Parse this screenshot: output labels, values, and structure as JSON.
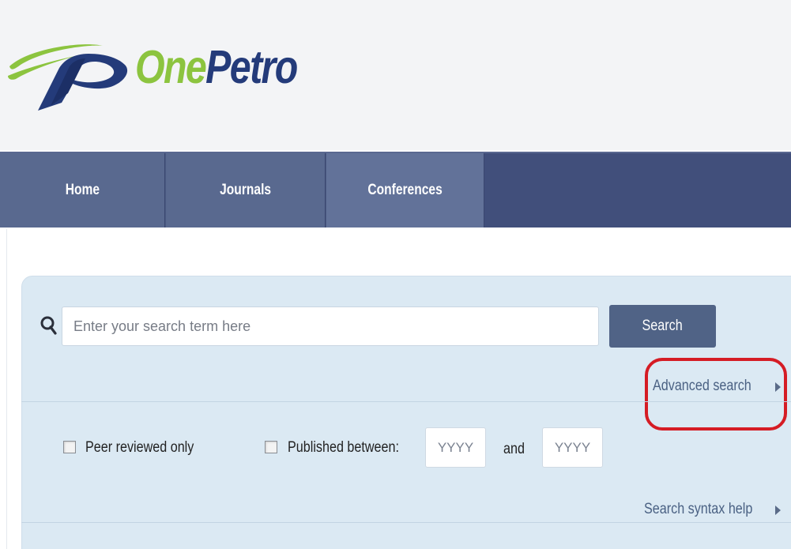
{
  "logo": {
    "text_one": "One",
    "text_petro": "Petro",
    "colors": {
      "green": "#8cc43f",
      "navy": "#243b7a"
    }
  },
  "nav": {
    "items": [
      {
        "label": "Home"
      },
      {
        "label": "Journals"
      },
      {
        "label": "Conferences"
      }
    ]
  },
  "search": {
    "icon": "search-icon",
    "placeholder": "Enter your search term here",
    "value": "",
    "button_label": "Search",
    "advanced_link": "Advanced search",
    "highlight_color": "#d51c24"
  },
  "filters": {
    "peer_reviewed_label": "Peer reviewed only",
    "peer_reviewed_checked": false,
    "published_between_label": "Published between:",
    "published_between_checked": false,
    "year_from_placeholder": "YYYY",
    "and_label": "and",
    "year_to_placeholder": "YYYY"
  },
  "help": {
    "syntax_link": "Search syntax help"
  }
}
